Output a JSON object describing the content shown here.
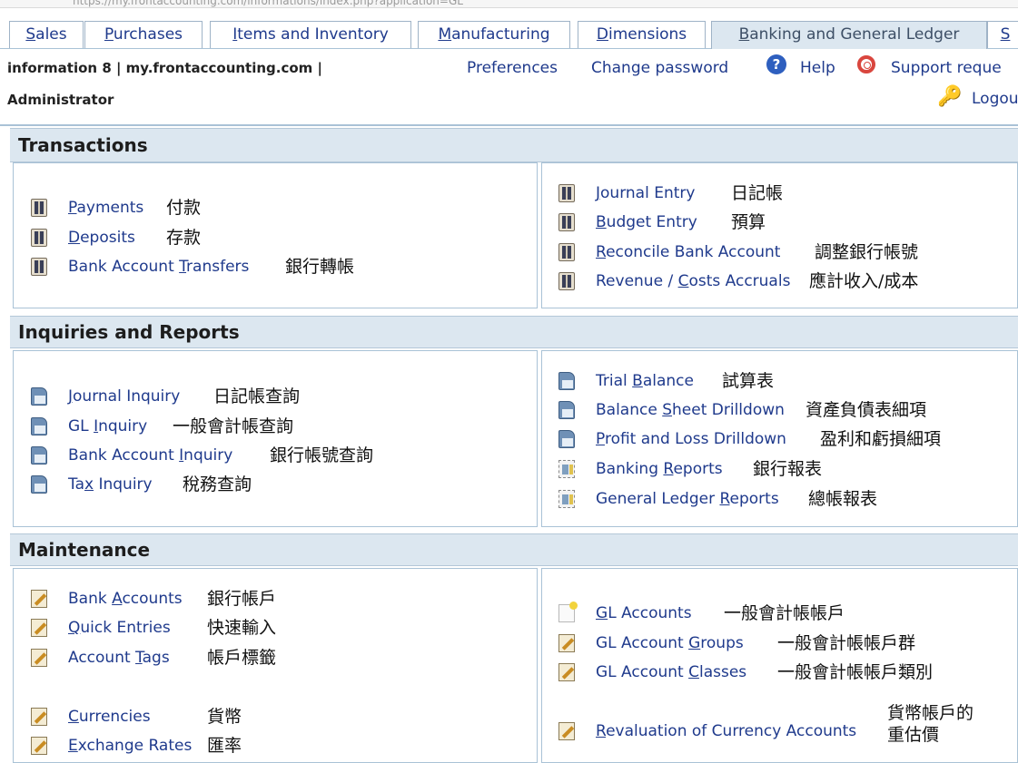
{
  "browser": {
    "url": "https://my.frontaccounting.com/informations/index.php?application=GL"
  },
  "tabs": [
    {
      "label": "Sales",
      "underline_pos": 0
    },
    {
      "label": "Purchases",
      "underline_pos": 0
    },
    {
      "label": "Items and Inventory",
      "underline_pos": 0
    },
    {
      "label": "Manufacturing",
      "underline_pos": 0
    },
    {
      "label": "Dimensions",
      "underline_pos": 0
    },
    {
      "label": "Banking and General Ledger",
      "underline_pos": 0
    },
    {
      "label": "S",
      "underline_pos": 0
    }
  ],
  "header": {
    "company": "information 8 | my.frontaccounting.com |",
    "user": "Administrator",
    "links": {
      "preferences": "Preferences",
      "change_password": "Change password",
      "help": "Help",
      "support": "Support reque",
      "logout": "Logou"
    },
    "icons": {
      "help": "help-icon",
      "support": "lifebuoy-icon",
      "logout": "key-icon"
    }
  },
  "sections": [
    {
      "title": "Transactions",
      "left": [
        {
          "label": "Payments",
          "chinese": "付款",
          "icon": "book-icon",
          "underline": 0
        },
        {
          "label": "Deposits",
          "chinese": "存款",
          "icon": "book-icon",
          "underline": 0
        },
        {
          "label": "Bank Account Transfers",
          "chinese": "銀行轉帳",
          "icon": "book-icon",
          "underline": 13
        }
      ],
      "right": [
        {
          "label": "Journal Entry",
          "chinese": "日記帳",
          "icon": "book-icon",
          "underline": 0
        },
        {
          "label": "Budget Entry",
          "chinese": "預算",
          "icon": "book-icon",
          "underline": 0
        },
        {
          "label": "Reconcile Bank Account",
          "chinese": "調整銀行帳號",
          "icon": "book-icon",
          "underline": 0
        },
        {
          "label": "Revenue / Costs Accruals",
          "chinese": "應計收入/成本",
          "icon": "book-icon",
          "underline": 10
        }
      ]
    },
    {
      "title": "Inquiries and Reports",
      "left": [
        {
          "label": "Journal Inquiry",
          "chinese": "日記帳查詢",
          "icon": "document-icon",
          "underline": 0
        },
        {
          "label": "GL Inquiry",
          "chinese": "一般會計帳查詢",
          "icon": "document-icon",
          "underline": 3
        },
        {
          "label": "Bank Account Inquiry",
          "chinese": "銀行帳號查詢",
          "icon": "document-icon",
          "underline": 13
        },
        {
          "label": "Tax Inquiry",
          "chinese": "稅務查詢",
          "icon": "document-icon",
          "underline": 2
        }
      ],
      "right": [
        {
          "label": "Trial Balance",
          "chinese": "試算表",
          "icon": "document-icon",
          "underline": 6
        },
        {
          "label": "Balance Sheet Drilldown",
          "chinese": "資產負債表細項",
          "icon": "document-icon",
          "underline": 8
        },
        {
          "label": "Profit and Loss Drilldown",
          "chinese": "盈利和虧損細項",
          "icon": "document-icon",
          "underline": 0
        },
        {
          "label": "Banking Reports",
          "chinese": "銀行報表",
          "icon": "report-icon",
          "underline": 8
        },
        {
          "label": "General Ledger Reports",
          "chinese": "總帳報表",
          "icon": "report-icon",
          "underline": 15
        }
      ]
    },
    {
      "title": "Maintenance",
      "left": [
        {
          "label": "Bank Accounts",
          "chinese": "銀行帳戶",
          "icon": "pencil-icon",
          "underline": 5
        },
        {
          "label": "Quick Entries",
          "chinese": "快速輸入",
          "icon": "pencil-icon",
          "underline": 0
        },
        {
          "label": "Account Tags",
          "chinese": "帳戶標籤",
          "icon": "pencil-icon",
          "underline": 8
        },
        {
          "label": "Currencies",
          "chinese": "貨幣",
          "icon": "pencil-icon",
          "underline": 0
        },
        {
          "label": "Exchange Rates",
          "chinese": "匯率",
          "icon": "pencil-icon",
          "underline": 0
        }
      ],
      "right": [
        {
          "label": "GL Accounts",
          "chinese": "一般會計帳帳戶",
          "icon": "new-page-icon",
          "underline": 0
        },
        {
          "label": "GL Account Groups",
          "chinese": "一般會計帳帳戶群",
          "icon": "pencil-icon",
          "underline": 11
        },
        {
          "label": "GL Account Classes",
          "chinese": "一般會計帳帳戶類別",
          "icon": "pencil-icon",
          "underline": 11
        },
        {
          "label": "Revaluation of Currency Accounts",
          "chinese": "貨幣帳戶的重估價",
          "chinese_lines": [
            "貨幣帳戶的",
            "重估價"
          ],
          "icon": "pencil-icon",
          "underline": 0
        }
      ]
    }
  ]
}
